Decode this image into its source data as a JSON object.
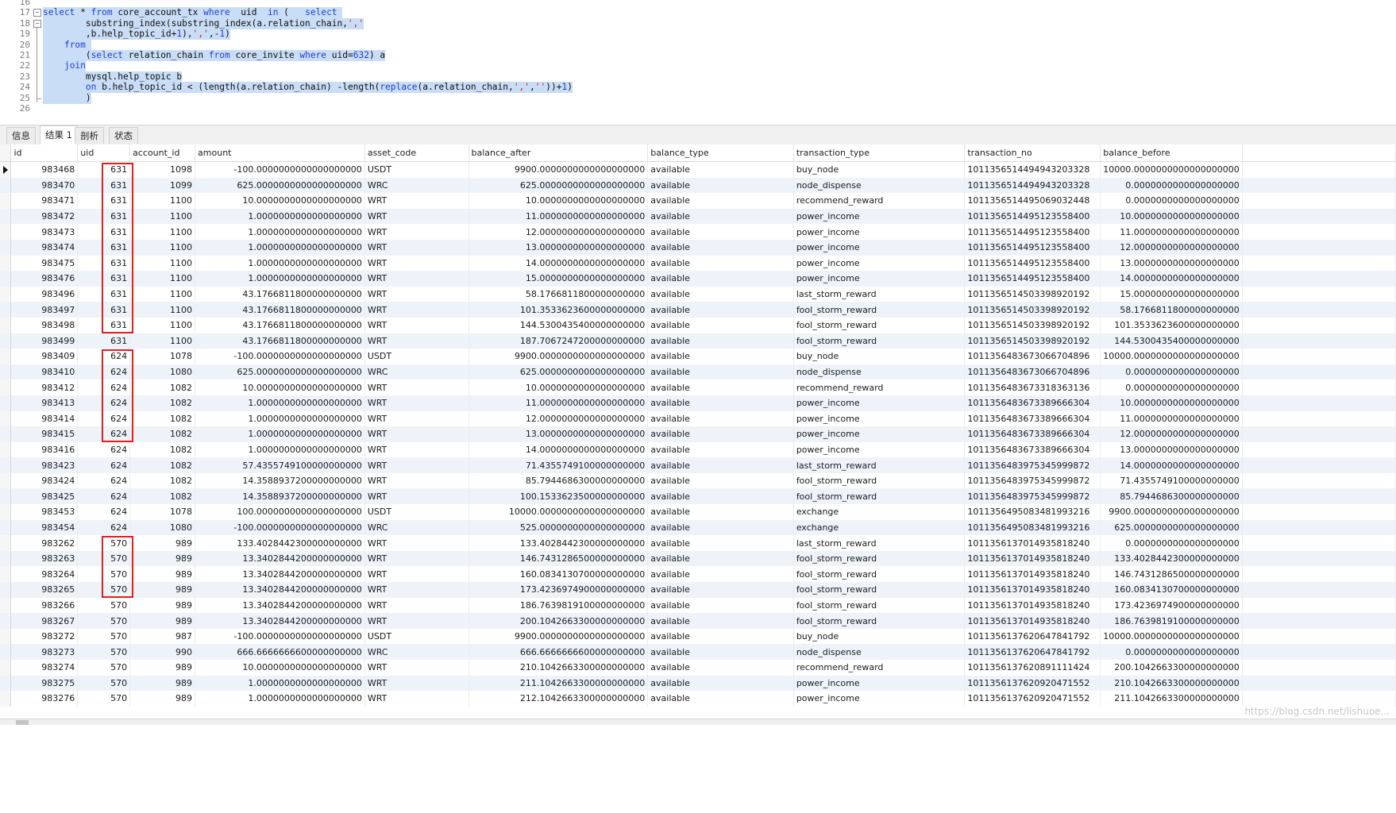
{
  "editor": {
    "lines": [
      {
        "num": "16",
        "html": ""
      },
      {
        "num": "17",
        "html": "<span class=\"kw\">select</span> * <span class=\"kw\">from</span> core_account_tx <span class=\"kw\">where</span>  uid  <span class=\"kw\">in</span> (   <span class=\"kw\">select</span> ",
        "fold": "box"
      },
      {
        "num": "18",
        "html": "        substring_index(substring_index(a.relation_chain,<span class=\"str\">','</span>",
        "fold": "box"
      },
      {
        "num": "19",
        "html": "        ,b.help_topic_id+<span class=\"num\">1</span>),<span class=\"str\">','</span>,-<span class=\"num\">1</span>)"
      },
      {
        "num": "20",
        "html": "    <span class=\"kw\">from</span> "
      },
      {
        "num": "21",
        "html": "        (<span class=\"kw\">select</span> relation_chain <span class=\"kw\">from</span> core_invite <span class=\"kw\">where</span> uid=<span class=\"num\">632</span>) a"
      },
      {
        "num": "22",
        "html": "    <span class=\"kw\">join</span>"
      },
      {
        "num": "23",
        "html": "        mysql.help_topic b"
      },
      {
        "num": "24",
        "html": "        <span class=\"kw\">on</span> b.help_topic_id &lt; (length(a.relation_chain) -length(<span class=\"kw\">replace</span>(a.relation_chain,<span class=\"str\">','</span>,<span class=\"str\">''</span>))+<span class=\"num\">1</span>)"
      },
      {
        "num": "25",
        "html": "        )",
        "fold": "end"
      },
      {
        "num": "26",
        "html": ""
      }
    ]
  },
  "tabs": [
    {
      "label": "信息",
      "active": false
    },
    {
      "label": "结果 1",
      "active": true
    },
    {
      "label": "剖析",
      "active": false
    },
    {
      "label": "状态",
      "active": false
    }
  ],
  "columns": [
    "id",
    "uid",
    "account_id",
    "amount",
    "asset_code",
    "balance_after",
    "balance_type",
    "transaction_type",
    "transaction_no",
    "balance_before",
    ""
  ],
  "rows": [
    [
      "983468",
      "631",
      "1098",
      "-100.0000000000000000000",
      "USDT",
      "9900.0000000000000000000",
      "available",
      "buy_node",
      "1011356514494943203328",
      "10000.0000000000000000000",
      ""
    ],
    [
      "983470",
      "631",
      "1099",
      "625.0000000000000000000",
      "WRC",
      "625.0000000000000000000",
      "available",
      "node_dispense",
      "1011356514494943203328",
      "0.0000000000000000000",
      ""
    ],
    [
      "983471",
      "631",
      "1100",
      "10.0000000000000000000",
      "WRT",
      "10.0000000000000000000",
      "available",
      "recommend_reward",
      "1011356514495069032448",
      "0.0000000000000000000",
      ""
    ],
    [
      "983472",
      "631",
      "1100",
      "1.0000000000000000000",
      "WRT",
      "11.0000000000000000000",
      "available",
      "power_income",
      "1011356514495123558400",
      "10.0000000000000000000",
      ""
    ],
    [
      "983473",
      "631",
      "1100",
      "1.0000000000000000000",
      "WRT",
      "12.0000000000000000000",
      "available",
      "power_income",
      "1011356514495123558400",
      "11.0000000000000000000",
      ""
    ],
    [
      "983474",
      "631",
      "1100",
      "1.0000000000000000000",
      "WRT",
      "13.0000000000000000000",
      "available",
      "power_income",
      "1011356514495123558400",
      "12.0000000000000000000",
      ""
    ],
    [
      "983475",
      "631",
      "1100",
      "1.0000000000000000000",
      "WRT",
      "14.0000000000000000000",
      "available",
      "power_income",
      "1011356514495123558400",
      "13.0000000000000000000",
      ""
    ],
    [
      "983476",
      "631",
      "1100",
      "1.0000000000000000000",
      "WRT",
      "15.0000000000000000000",
      "available",
      "power_income",
      "1011356514495123558400",
      "14.0000000000000000000",
      ""
    ],
    [
      "983496",
      "631",
      "1100",
      "43.1766811800000000000",
      "WRT",
      "58.1766811800000000000",
      "available",
      "last_storm_reward",
      "1011356514503398920192",
      "15.0000000000000000000",
      ""
    ],
    [
      "983497",
      "631",
      "1100",
      "43.1766811800000000000",
      "WRT",
      "101.3533623600000000000",
      "available",
      "fool_storm_reward",
      "1011356514503398920192",
      "58.1766811800000000000",
      ""
    ],
    [
      "983498",
      "631",
      "1100",
      "43.1766811800000000000",
      "WRT",
      "144.5300435400000000000",
      "available",
      "fool_storm_reward",
      "1011356514503398920192",
      "101.3533623600000000000",
      ""
    ],
    [
      "983499",
      "631",
      "1100",
      "43.1766811800000000000",
      "WRT",
      "187.7067247200000000000",
      "available",
      "fool_storm_reward",
      "1011356514503398920192",
      "144.5300435400000000000",
      ""
    ],
    [
      "983409",
      "624",
      "1078",
      "-100.0000000000000000000",
      "USDT",
      "9900.0000000000000000000",
      "available",
      "buy_node",
      "1011356483673066704896",
      "10000.0000000000000000000",
      ""
    ],
    [
      "983410",
      "624",
      "1080",
      "625.0000000000000000000",
      "WRC",
      "625.0000000000000000000",
      "available",
      "node_dispense",
      "1011356483673066704896",
      "0.0000000000000000000",
      ""
    ],
    [
      "983412",
      "624",
      "1082",
      "10.0000000000000000000",
      "WRT",
      "10.0000000000000000000",
      "available",
      "recommend_reward",
      "1011356483673318363136",
      "0.0000000000000000000",
      ""
    ],
    [
      "983413",
      "624",
      "1082",
      "1.0000000000000000000",
      "WRT",
      "11.0000000000000000000",
      "available",
      "power_income",
      "1011356483673389666304",
      "10.0000000000000000000",
      ""
    ],
    [
      "983414",
      "624",
      "1082",
      "1.0000000000000000000",
      "WRT",
      "12.0000000000000000000",
      "available",
      "power_income",
      "1011356483673389666304",
      "11.0000000000000000000",
      ""
    ],
    [
      "983415",
      "624",
      "1082",
      "1.0000000000000000000",
      "WRT",
      "13.0000000000000000000",
      "available",
      "power_income",
      "1011356483673389666304",
      "12.0000000000000000000",
      ""
    ],
    [
      "983416",
      "624",
      "1082",
      "1.0000000000000000000",
      "WRT",
      "14.0000000000000000000",
      "available",
      "power_income",
      "1011356483673389666304",
      "13.0000000000000000000",
      ""
    ],
    [
      "983423",
      "624",
      "1082",
      "57.4355749100000000000",
      "WRT",
      "71.4355749100000000000",
      "available",
      "last_storm_reward",
      "1011356483975345999872",
      "14.0000000000000000000",
      ""
    ],
    [
      "983424",
      "624",
      "1082",
      "14.3588937200000000000",
      "WRT",
      "85.7944686300000000000",
      "available",
      "fool_storm_reward",
      "1011356483975345999872",
      "71.4355749100000000000",
      ""
    ],
    [
      "983425",
      "624",
      "1082",
      "14.3588937200000000000",
      "WRT",
      "100.1533623500000000000",
      "available",
      "fool_storm_reward",
      "1011356483975345999872",
      "85.7944686300000000000",
      ""
    ],
    [
      "983453",
      "624",
      "1078",
      "100.0000000000000000000",
      "USDT",
      "10000.0000000000000000000",
      "available",
      "exchange",
      "1011356495083481993216",
      "9900.0000000000000000000",
      ""
    ],
    [
      "983454",
      "624",
      "1080",
      "-100.0000000000000000000",
      "WRC",
      "525.0000000000000000000",
      "available",
      "exchange",
      "1011356495083481993216",
      "625.0000000000000000000",
      ""
    ],
    [
      "983262",
      "570",
      "989",
      "133.4028442300000000000",
      "WRT",
      "133.4028442300000000000",
      "available",
      "last_storm_reward",
      "1011356137014935818240",
      "0.0000000000000000000",
      ""
    ],
    [
      "983263",
      "570",
      "989",
      "13.3402844200000000000",
      "WRT",
      "146.7431286500000000000",
      "available",
      "fool_storm_reward",
      "1011356137014935818240",
      "133.4028442300000000000",
      ""
    ],
    [
      "983264",
      "570",
      "989",
      "13.3402844200000000000",
      "WRT",
      "160.0834130700000000000",
      "available",
      "fool_storm_reward",
      "1011356137014935818240",
      "146.7431286500000000000",
      ""
    ],
    [
      "983265",
      "570",
      "989",
      "13.3402844200000000000",
      "WRT",
      "173.4236974900000000000",
      "available",
      "fool_storm_reward",
      "1011356137014935818240",
      "160.0834130700000000000",
      ""
    ],
    [
      "983266",
      "570",
      "989",
      "13.3402844200000000000",
      "WRT",
      "186.7639819100000000000",
      "available",
      "fool_storm_reward",
      "1011356137014935818240",
      "173.4236974900000000000",
      ""
    ],
    [
      "983267",
      "570",
      "989",
      "13.3402844200000000000",
      "WRT",
      "200.1042663300000000000",
      "available",
      "fool_storm_reward",
      "1011356137014935818240",
      "186.7639819100000000000",
      ""
    ],
    [
      "983272",
      "570",
      "987",
      "-100.0000000000000000000",
      "USDT",
      "9900.0000000000000000000",
      "available",
      "buy_node",
      "1011356137620647841792",
      "10000.0000000000000000000",
      ""
    ],
    [
      "983273",
      "570",
      "990",
      "666.6666666600000000000",
      "WRC",
      "666.6666666600000000000",
      "available",
      "node_dispense",
      "1011356137620647841792",
      "0.0000000000000000000",
      ""
    ],
    [
      "983274",
      "570",
      "989",
      "10.0000000000000000000",
      "WRT",
      "210.1042663300000000000",
      "available",
      "recommend_reward",
      "1011356137620891111424",
      "200.1042663300000000000",
      ""
    ],
    [
      "983275",
      "570",
      "989",
      "1.0000000000000000000",
      "WRT",
      "211.1042663300000000000",
      "available",
      "power_income",
      "1011356137620920471552",
      "210.1042663300000000000",
      ""
    ],
    [
      "983276",
      "570",
      "989",
      "1.0000000000000000000",
      "WRT",
      "212.1042663300000000000",
      "available",
      "power_income",
      "1011356137620920471552",
      "211.1042663300000000000",
      ""
    ]
  ],
  "highlight_groups": [
    {
      "uid": "631",
      "first_row": 0,
      "last_row": 10
    },
    {
      "uid": "624",
      "first_row": 12,
      "last_row": 17
    },
    {
      "uid": "570",
      "first_row": 24,
      "last_row": 27
    }
  ],
  "selected_row": 0,
  "watermark": "https://blog.csdn.net/lishuoe..."
}
